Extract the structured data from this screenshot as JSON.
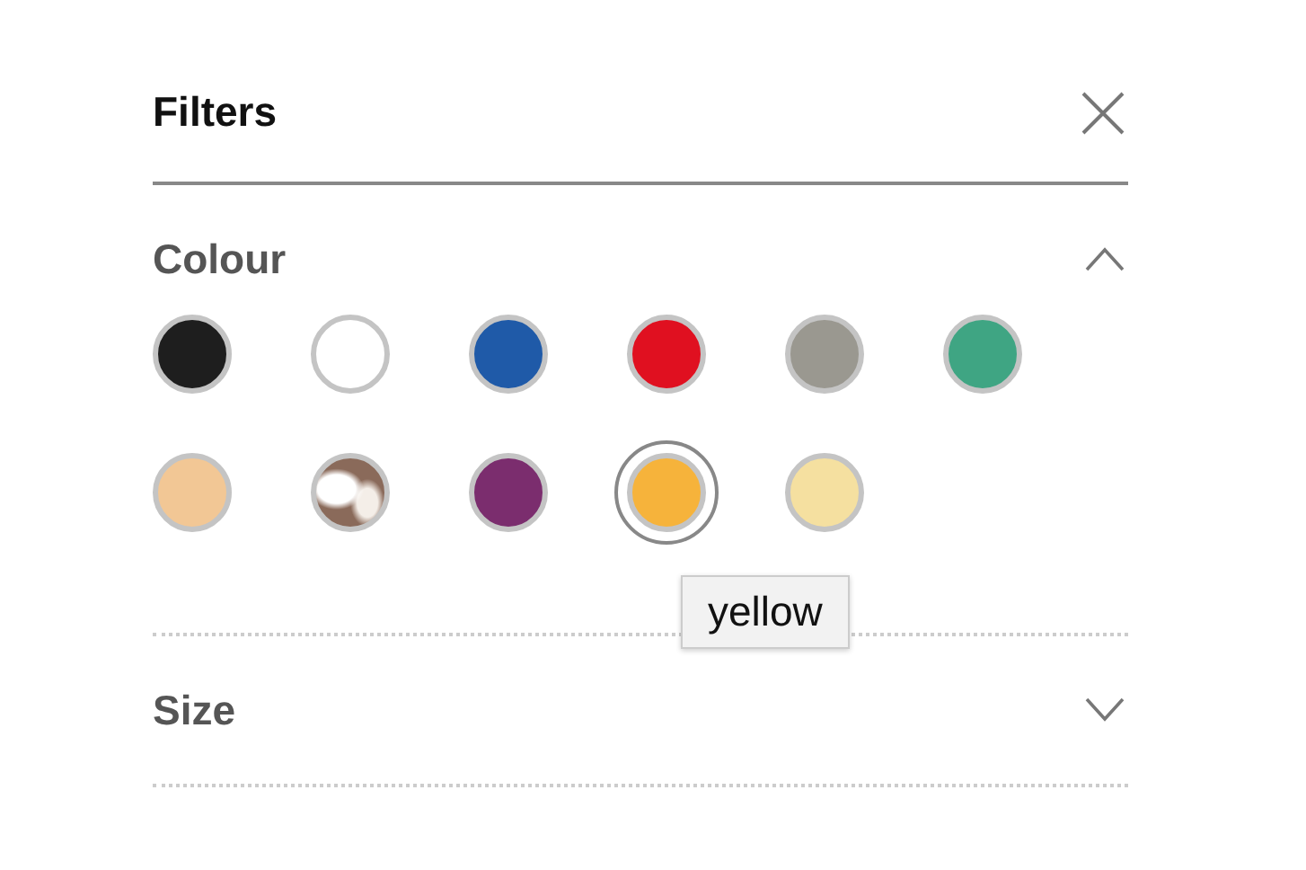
{
  "header": {
    "title": "Filters"
  },
  "sections": [
    {
      "title": "Colour",
      "expanded": true,
      "swatches": [
        {
          "kind": "solid",
          "color": "#1e1e1e",
          "selected": false
        },
        {
          "kind": "solid",
          "color": "#ffffff",
          "selected": false
        },
        {
          "kind": "solid",
          "color": "#1f5aa8",
          "selected": false
        },
        {
          "kind": "solid",
          "color": "#e01020",
          "selected": false
        },
        {
          "kind": "solid",
          "color": "#9a9890",
          "selected": false
        },
        {
          "kind": "solid",
          "color": "#3fa583",
          "selected": false
        },
        {
          "kind": "solid",
          "color": "#f2c795",
          "selected": false
        },
        {
          "kind": "pattern",
          "color": "#8a6a5a",
          "selected": false
        },
        {
          "kind": "solid",
          "color": "#7b2d6e",
          "selected": false
        },
        {
          "kind": "solid",
          "color": "#f6b33b",
          "selected": true,
          "tooltip": "yellow"
        },
        {
          "kind": "solid",
          "color": "#f5e0a0",
          "selected": false
        }
      ]
    },
    {
      "title": "Size",
      "expanded": false
    }
  ]
}
